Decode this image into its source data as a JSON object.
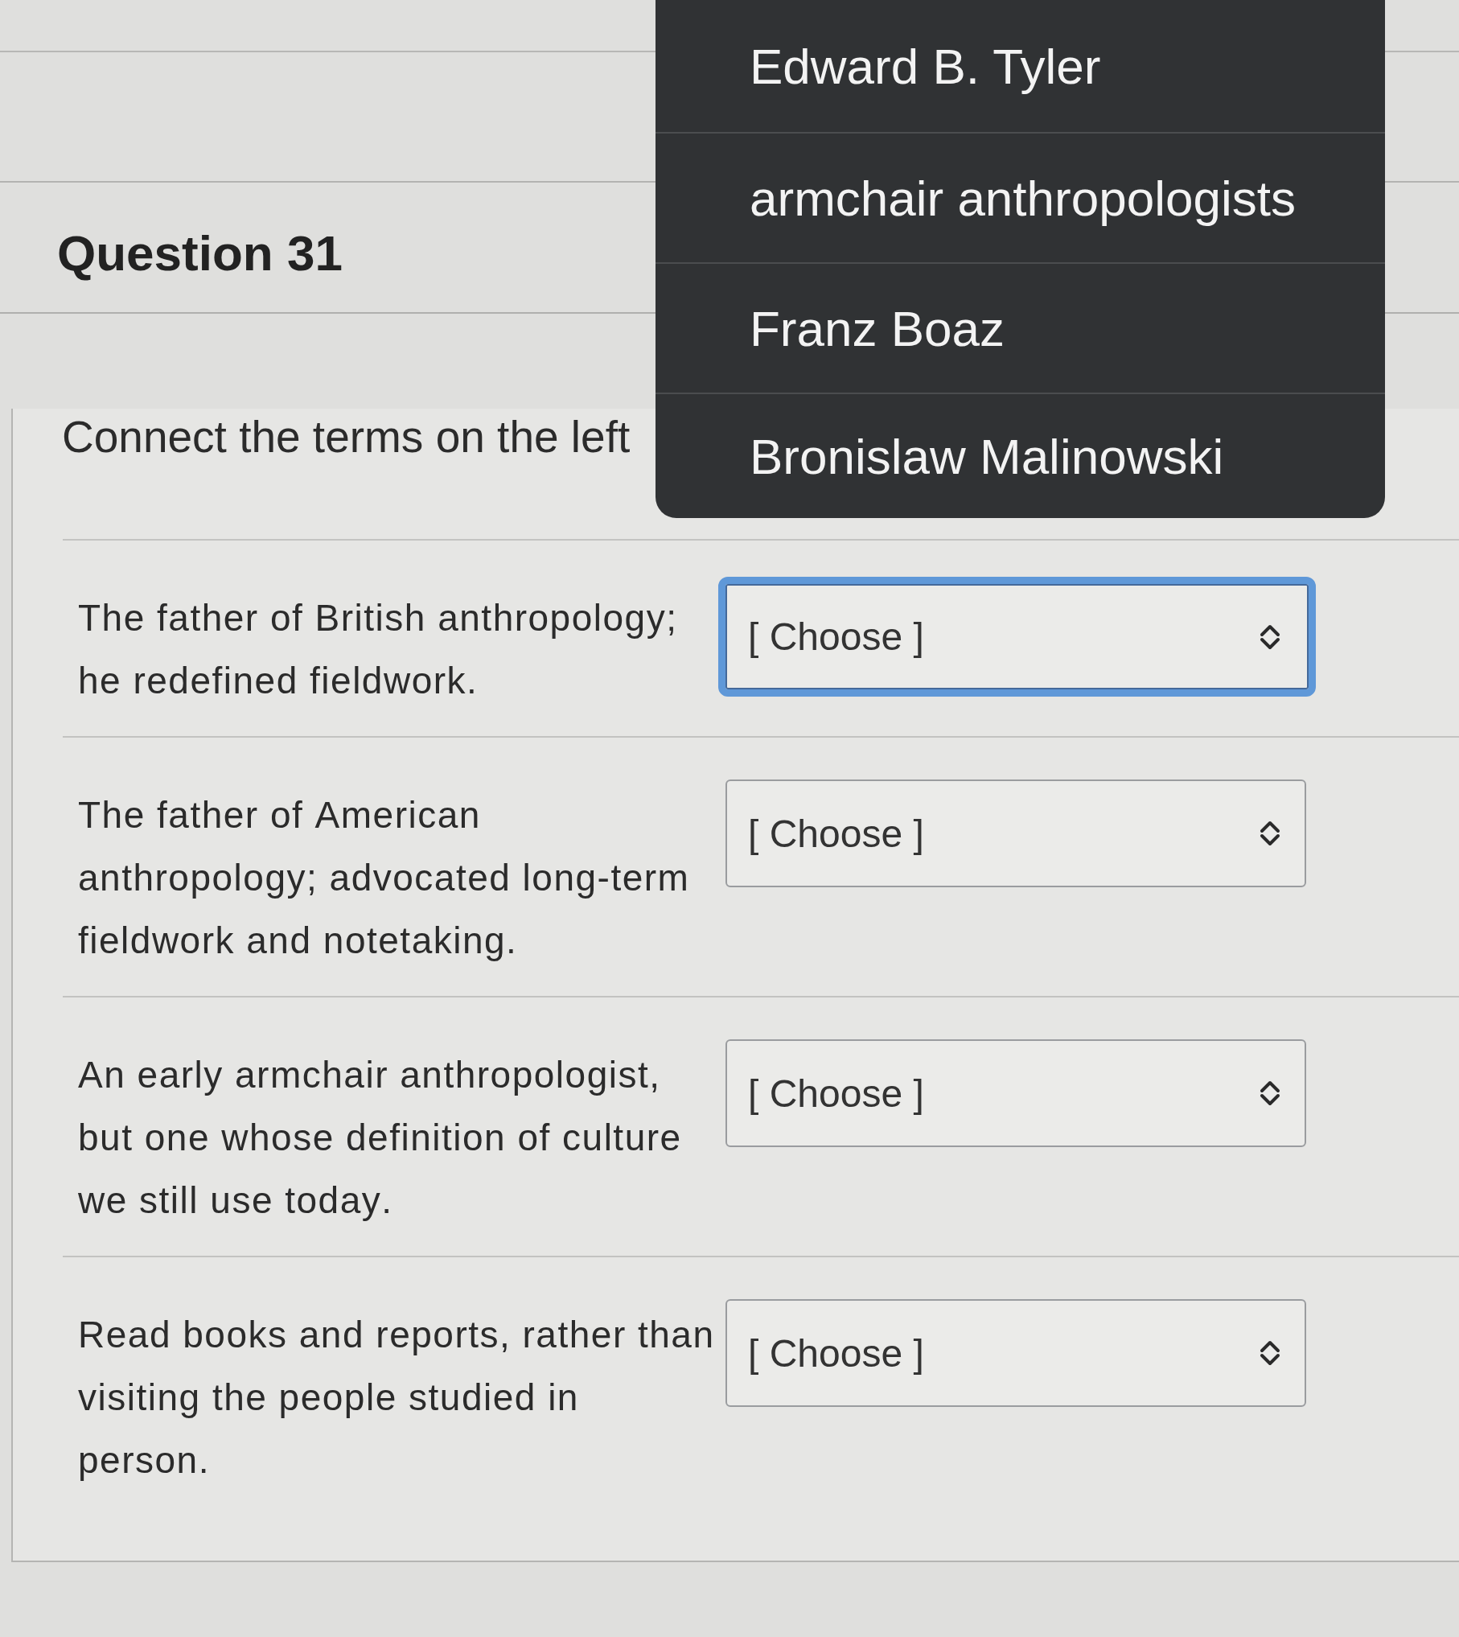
{
  "question": {
    "title": "Question 31",
    "instructions": "Connect the terms on the left",
    "rows": [
      {
        "prompt": "The father of British anthropology; he redefined fieldwork.",
        "select": {
          "value": "[ Choose ]",
          "focused": true
        }
      },
      {
        "prompt": "The father of American anthropology; advocated long-term fieldwork and notetaking.",
        "select": {
          "value": "[ Choose ]",
          "focused": false
        }
      },
      {
        "prompt": "An early armchair anthropologist, but one whose definition of culture we still use today.",
        "select": {
          "value": "[ Choose ]",
          "focused": false
        }
      },
      {
        "prompt": "Read books and reports, rather than visiting the people studied in person.",
        "select": {
          "value": "[ Choose ]",
          "focused": false
        }
      }
    ]
  },
  "dropdown_menu": {
    "options": [
      {
        "label": "Edward B. Tyler",
        "selected": false
      },
      {
        "label": "armchair anthropologists",
        "selected": false
      },
      {
        "label": "Franz Boaz",
        "selected": false
      },
      {
        "label": "Bronislaw Malinowski",
        "selected": false
      }
    ]
  }
}
